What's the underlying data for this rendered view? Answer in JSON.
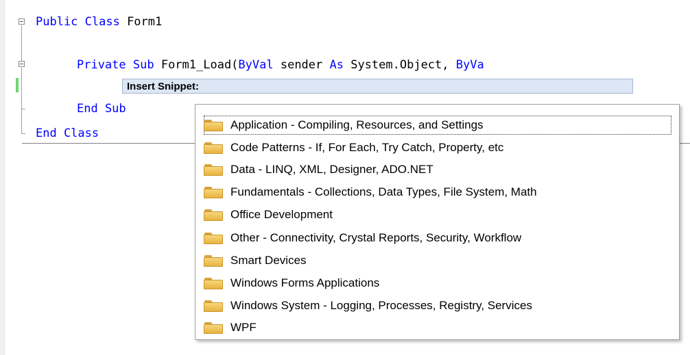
{
  "code": {
    "line1": {
      "kw": "Public Class",
      "rest": " Form1"
    },
    "line2": {
      "kw1": "Private Sub",
      "mid1": " Form1_Load(",
      "kw2": "ByVal",
      "mid2": " sender ",
      "kw3": "As",
      "mid3": " System.Object, ",
      "kw4": "ByVa"
    },
    "line3": {
      "kw": "End Sub"
    },
    "line4": {
      "kw": "End Class"
    }
  },
  "snippet": {
    "prompt_label": "Insert Snippet:",
    "items": [
      {
        "label": "Application - Compiling, Resources, and Settings",
        "icon": "folder-icon",
        "selected": true
      },
      {
        "label": "Code Patterns - If, For Each, Try Catch, Property, etc",
        "icon": "folder-icon"
      },
      {
        "label": "Data - LINQ, XML, Designer, ADO.NET",
        "icon": "folder-icon"
      },
      {
        "label": "Fundamentals - Collections, Data Types, File System, Math",
        "icon": "folder-icon"
      },
      {
        "label": "Office Development",
        "icon": "folder-icon"
      },
      {
        "label": "Other - Connectivity, Crystal Reports, Security, Workflow",
        "icon": "folder-icon"
      },
      {
        "label": "Smart Devices",
        "icon": "folder-icon"
      },
      {
        "label": "Windows Forms Applications",
        "icon": "folder-icon"
      },
      {
        "label": "Windows System - Logging, Processes, Registry, Services",
        "icon": "folder-icon"
      },
      {
        "label": "WPF",
        "icon": "folder-icon"
      }
    ]
  },
  "colors": {
    "keyword": "#0000ff",
    "snippet_bar": "#dce6f4",
    "change_bar": "#6ed76e"
  }
}
